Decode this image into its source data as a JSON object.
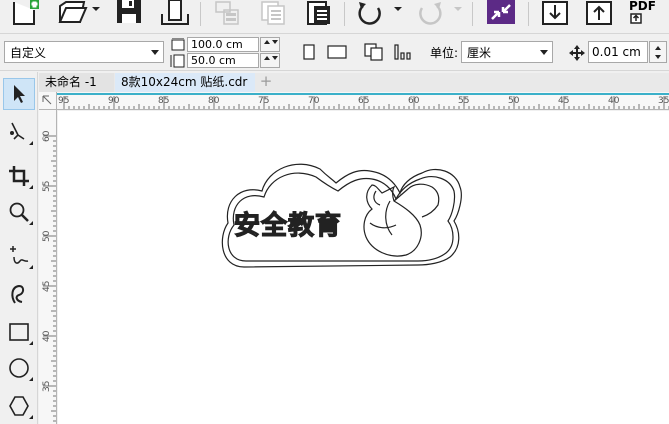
{
  "property_bar": {
    "page_size_select": "自定义",
    "width_value": "100.0 cm",
    "height_value": "50.0 cm",
    "unit_label": "单位:",
    "unit_select": "厘米",
    "nudge_value": "0.01 cm"
  },
  "tabs": [
    {
      "label": "未命名 -1",
      "active": false
    },
    {
      "label": "8款10x24cm 贴纸.cdr",
      "active": true
    }
  ],
  "tab_add_label": "+",
  "ruler_h": {
    "labels": [
      "95",
      "90",
      "85",
      "80",
      "75",
      "70",
      "65",
      "60",
      "55",
      "50",
      "45",
      "40",
      "35"
    ]
  },
  "ruler_v": {
    "labels": [
      "60",
      "55",
      "50",
      "45",
      "40",
      "35"
    ]
  },
  "canvas": {
    "sticker_text": "安全教育"
  },
  "toolbar_top": {
    "pdf_label": "PDF"
  },
  "colors": {
    "accent_purple": "#5c2a86",
    "new_doc_green": "#2aa33a",
    "guide_cyan": "#3bb0c9"
  },
  "icons": [
    "new-document-icon",
    "open-icon",
    "save-icon",
    "import-icon",
    "cut-icon",
    "copy-icon",
    "paste-icon",
    "undo-icon",
    "redo-icon",
    "corel-connect-icon",
    "export-down-icon",
    "upload-icon",
    "pdf-icon"
  ],
  "tools": [
    "pick-tool",
    "shape-tool",
    "crop-tool",
    "zoom-tool",
    "freehand-tool",
    "artistic-media-tool",
    "rectangle-tool",
    "ellipse-tool",
    "polygon-tool"
  ]
}
